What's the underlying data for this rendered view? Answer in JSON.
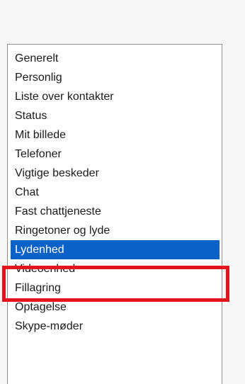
{
  "settings_list": {
    "items": [
      {
        "label": "Generelt",
        "selected": false
      },
      {
        "label": "Personlig",
        "selected": false
      },
      {
        "label": "Liste over kontakter",
        "selected": false
      },
      {
        "label": "Status",
        "selected": false
      },
      {
        "label": "Mit billede",
        "selected": false
      },
      {
        "label": "Telefoner",
        "selected": false
      },
      {
        "label": "Vigtige beskeder",
        "selected": false
      },
      {
        "label": "Chat",
        "selected": false
      },
      {
        "label": "Fast chattjeneste",
        "selected": false
      },
      {
        "label": "Ringetoner og lyde",
        "selected": false
      },
      {
        "label": "Lydenhed",
        "selected": true
      },
      {
        "label": "Videoenhed",
        "selected": false
      },
      {
        "label": "Fillagring",
        "selected": false
      },
      {
        "label": "Optagelse",
        "selected": false
      },
      {
        "label": "Skype-møder",
        "selected": false
      }
    ]
  },
  "colors": {
    "selection_background": "#0a62c9",
    "highlight_border": "#e3141b"
  }
}
